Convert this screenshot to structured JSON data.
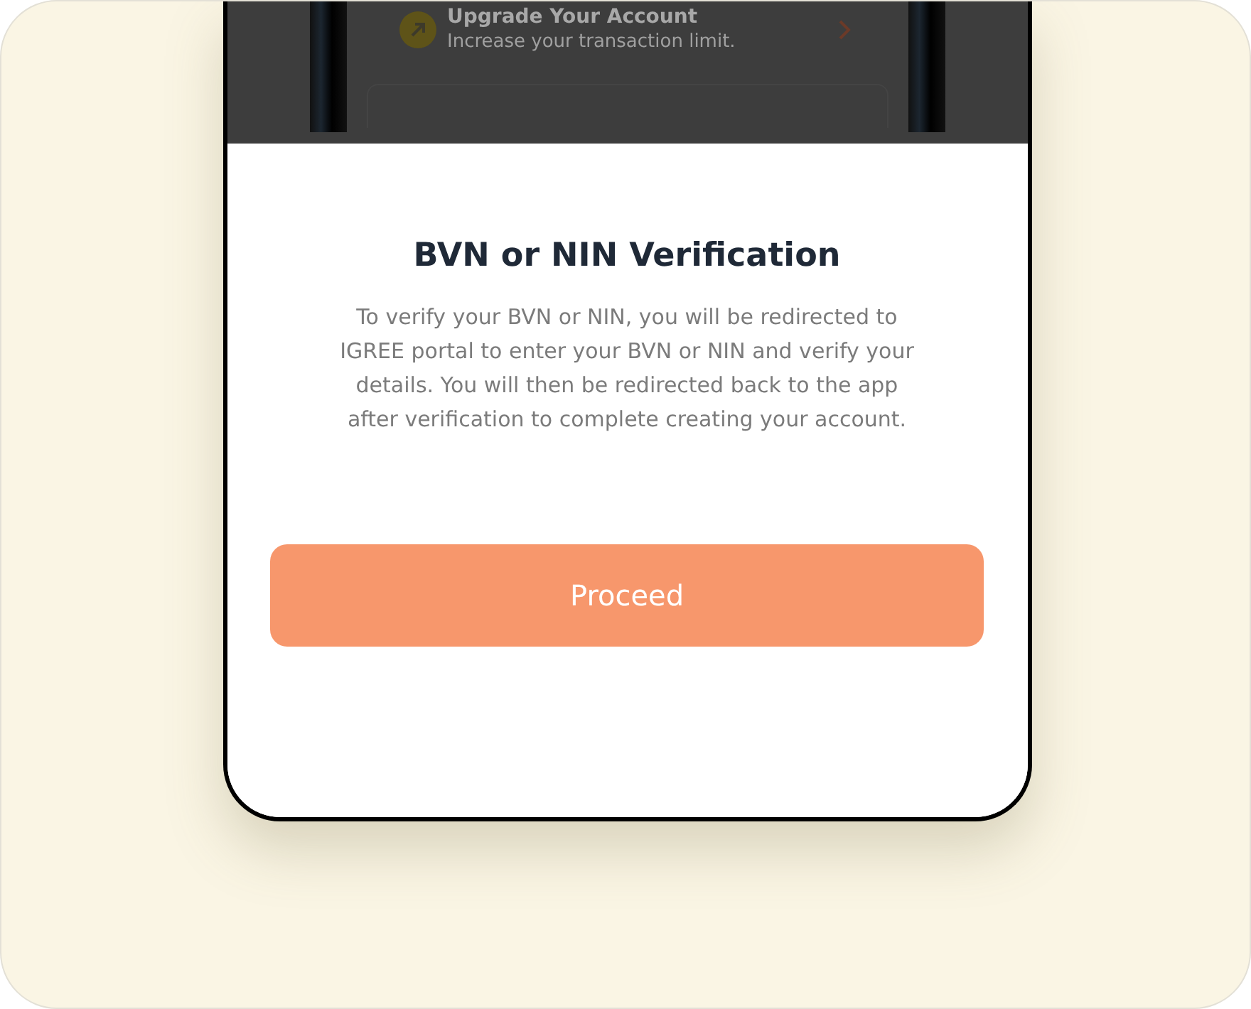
{
  "background_screen": {
    "item": {
      "title": "Upgrade Your Account",
      "subtitle": "Increase your transaction limit."
    }
  },
  "dialog": {
    "title": "BVN or NIN Verification",
    "message": "To verify your BVN or NIN, you will be redirected to IGREE portal to enter your BVN or NIN and verify your details. You will then be redirected back to the app after verification to complete creating your account.",
    "button": "Proceed"
  }
}
